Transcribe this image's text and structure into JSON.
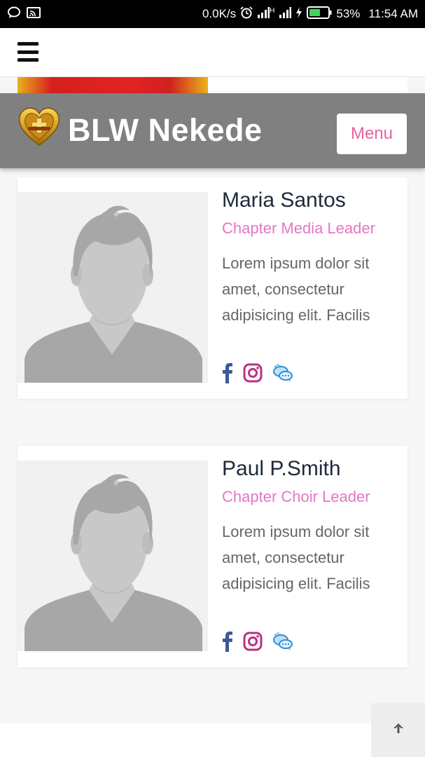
{
  "status_bar": {
    "network_speed": "0.0K/s",
    "network_type": "H",
    "battery_percent": "53%",
    "time": "11:54 AM",
    "icons": [
      "chat-bubble-icon",
      "cast-icon",
      "alarm-icon",
      "signal-icon",
      "signal-icon",
      "charging-icon",
      "battery-icon"
    ]
  },
  "nav": {
    "menu_icon": "hamburger-icon"
  },
  "brand": {
    "title": "BLW Nekede",
    "menu_label": "Menu",
    "logo_icon": "heart-crest-logo"
  },
  "leaders": [
    {
      "name": "Maria Santos",
      "role": "Chapter Media Leader",
      "bio": "Lorem ipsum dolor sit amet, consectetur adipisicing elit. Facilis",
      "avatar": "placeholder-person-avatar"
    },
    {
      "name": "Paul P.Smith",
      "role": "Chapter Choir Leader",
      "bio": "Lorem ipsum dolor sit amet, consectetur adipisicing elit. Facilis",
      "avatar": "placeholder-person-avatar"
    }
  ],
  "social_icons": [
    "facebook-icon",
    "instagram-icon",
    "chat-icon"
  ],
  "back_to_top_icon": "arrow-up-icon",
  "colors": {
    "accent_pink": "#e775c6",
    "menu_text": "#e8629f",
    "header_gray": "#808080",
    "facebook_blue": "#3b5998",
    "instagram_magenta": "#b8327f",
    "chat_blue": "#2d8fd6"
  }
}
